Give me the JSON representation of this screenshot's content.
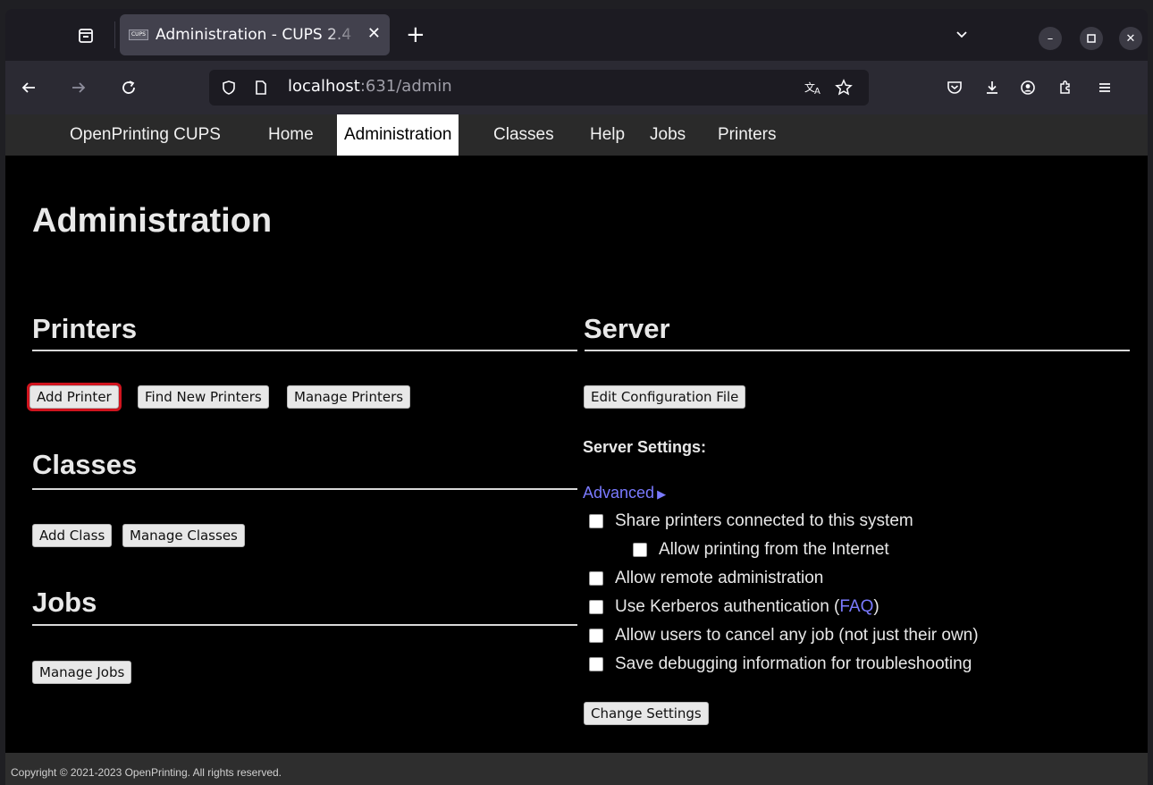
{
  "browser": {
    "tab_title": "Administration - CUPS 2.4",
    "favicon_text": "CUPS",
    "url_host": "localhost",
    "url_rest": ":631/admin",
    "icons": {
      "tab_list": "tab-list-icon",
      "new_tab": "plus-icon",
      "close_tab": "close-icon",
      "back": "back-arrow-icon",
      "forward": "forward-arrow-icon",
      "reload": "reload-icon",
      "shield": "tracking-shield-icon",
      "page": "page-icon",
      "translate": "translate-icon",
      "bookmark": "star-icon",
      "pocket": "pocket-icon",
      "downloads": "download-icon",
      "account": "account-icon",
      "extensions": "extensions-icon",
      "menu": "hamburger-menu-icon",
      "list_tabs": "chevron-down-icon",
      "minimize": "minimize-icon",
      "maximize": "maximize-icon",
      "close_window": "close-icon"
    }
  },
  "cups_nav": {
    "brand": "OpenPrinting CUPS",
    "home": "Home",
    "administration": "Administration",
    "classes": "Classes",
    "help": "Help",
    "jobs": "Jobs",
    "printers": "Printers",
    "active": "Administration"
  },
  "page": {
    "title": "Administration",
    "printers": {
      "heading": "Printers",
      "add_printer": "Add Printer",
      "find_new_printers": "Find New Printers",
      "manage_printers": "Manage Printers"
    },
    "classes": {
      "heading": "Classes",
      "add_class": "Add Class",
      "manage_classes": "Manage Classes"
    },
    "jobs": {
      "heading": "Jobs",
      "manage_jobs": "Manage Jobs"
    },
    "server": {
      "heading": "Server",
      "edit_config": "Edit Configuration File",
      "settings_label": "Server Settings:",
      "advanced": "Advanced",
      "advanced_arrow": "▶",
      "options": {
        "share_printers": "Share printers connected to this system",
        "allow_internet": "Allow printing from the Internet",
        "remote_admin": "Allow remote administration",
        "kerberos": "Use Kerberos authentication (",
        "kerberos_link": "FAQ",
        "kerberos_end": ")",
        "cancel_any": "Allow users to cancel any job (not just their own)",
        "debug": "Save debugging information for troubleshooting"
      },
      "change_settings": "Change Settings"
    },
    "footer": "Copyright © 2021-2023 OpenPrinting. All rights reserved."
  },
  "colors": {
    "page_bg": "#000000",
    "nav_bg": "#2a2a2a",
    "link": "#7a7aff",
    "focus_outline": "#d0141e"
  }
}
